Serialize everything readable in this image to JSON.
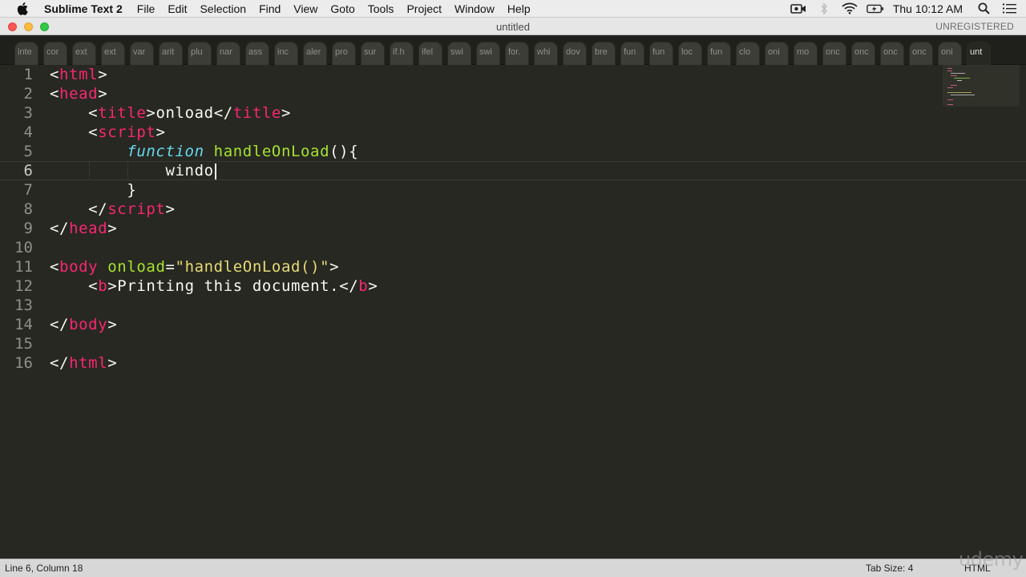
{
  "menubar": {
    "app_name": "Sublime Text 2",
    "items": [
      "File",
      "Edit",
      "Selection",
      "Find",
      "View",
      "Goto",
      "Tools",
      "Project",
      "Window",
      "Help"
    ],
    "clock": "Thu 10:12 AM"
  },
  "window": {
    "title": "untitled",
    "registration": "UNREGISTERED"
  },
  "tabs": [
    "inte",
    "cor",
    "ext",
    "ext",
    "var",
    "arit",
    "plu",
    "nar",
    "ass",
    "inc",
    "aler",
    "pro",
    "sur",
    "if.h",
    "ifel",
    "swi",
    "swi",
    "for.",
    "whi",
    "dov",
    "bre",
    "fun",
    "fun",
    "loc",
    "fun",
    "clo",
    "oni",
    "mo",
    "onc",
    "onc",
    "onc",
    "onc",
    "oni",
    "unt"
  ],
  "editor": {
    "line_numbers": [
      "1",
      "2",
      "3",
      "4",
      "5",
      "6",
      "7",
      "8",
      "9",
      "10",
      "11",
      "12",
      "13",
      "14",
      "15",
      "16"
    ],
    "current_line": 6,
    "tokens": {
      "lt": "<",
      "gt": ">",
      "lts": "</",
      "html": "html",
      "head": "head",
      "title": "title",
      "script": "script",
      "body": "body",
      "b": "b",
      "onload_text": "onload",
      "function_kw": "function",
      "fn_name": "handleOnLoad",
      "fn_parens": "(){",
      "typed": "windo",
      "close_brace": "}",
      "onload_attr": "onload",
      "eq": "=",
      "attr_value": "\"handleOnLoad()\"",
      "b_text": "Printing this document."
    }
  },
  "statusbar": {
    "position": "Line 6, Column 18",
    "tab_size": "Tab Size: 4",
    "syntax": "HTML"
  },
  "watermark": "udemy",
  "colors": {
    "background": "#272822",
    "tag": "#f92672",
    "attribute": "#a6e22e",
    "keyword": "#66d9ef",
    "string": "#e6db74"
  }
}
